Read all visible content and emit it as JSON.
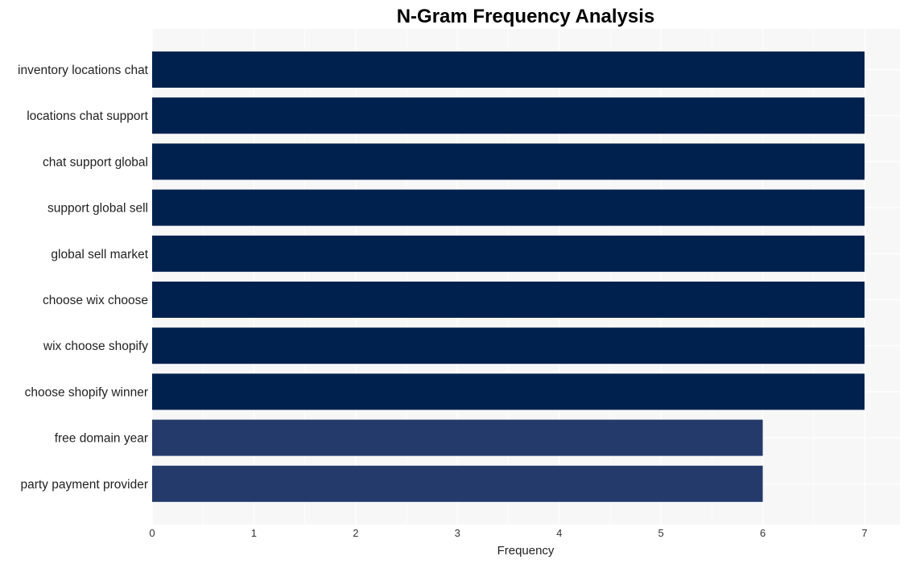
{
  "chart_data": {
    "type": "bar",
    "orientation": "horizontal",
    "title": "N-Gram Frequency Analysis",
    "xlabel": "Frequency",
    "ylabel": "",
    "xlim": [
      0,
      7.35
    ],
    "xticks": [
      0,
      1,
      2,
      3,
      4,
      5,
      6,
      7
    ],
    "grid": true,
    "categories": [
      "inventory locations chat",
      "locations chat support",
      "chat support global",
      "support global sell",
      "global sell market",
      "choose wix choose",
      "wix choose shopify",
      "choose shopify winner",
      "free domain year",
      "party payment provider"
    ],
    "values": [
      7,
      7,
      7,
      7,
      7,
      7,
      7,
      7,
      6,
      6
    ],
    "colors": {
      "max": "#00214e",
      "other": "#233a6b",
      "panel_background": "#f7f7f7",
      "gridline": "#ffffff"
    }
  }
}
